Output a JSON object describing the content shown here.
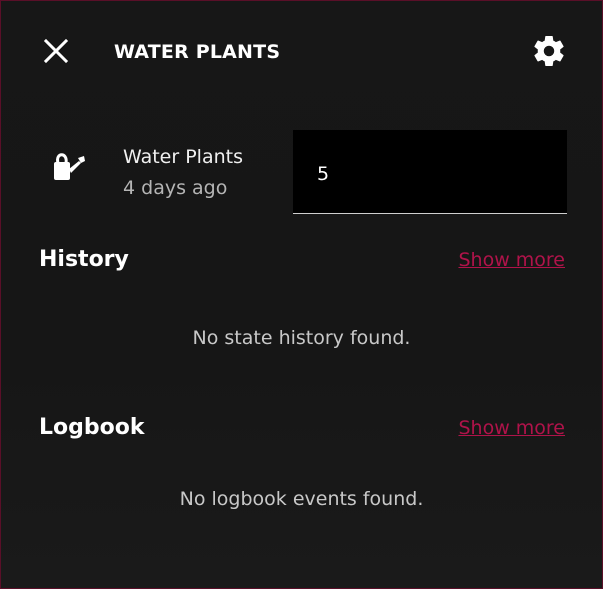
{
  "dialog": {
    "title": "WATER PLANTS",
    "close_icon": "close-icon",
    "settings_icon": "gear-icon"
  },
  "entity": {
    "icon": "watering-can-icon",
    "name": "Water Plants",
    "last_changed": "4 days ago",
    "value": "5"
  },
  "history": {
    "title": "History",
    "show_more": "Show more",
    "empty_message": "No state history found."
  },
  "logbook": {
    "title": "Logbook",
    "show_more": "Show more",
    "empty_message": "No logbook events found."
  },
  "colors": {
    "accent": "#b0134a",
    "border": "#5a0f28",
    "background": "#161616"
  }
}
